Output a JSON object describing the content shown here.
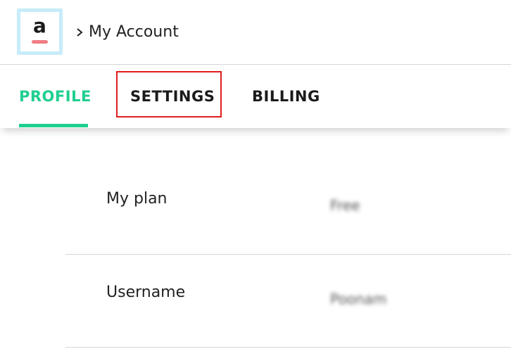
{
  "header": {
    "logo_letter": "a",
    "breadcrumb_title": "My Account",
    "accent_colors": {
      "logo_border": "#c8ecf9",
      "logo_bar": "#f07d84"
    }
  },
  "tabs": [
    {
      "label": "PROFILE",
      "active": true
    },
    {
      "label": "SETTINGS",
      "active": false,
      "highlighted": true
    },
    {
      "label": "BILLING",
      "active": false
    }
  ],
  "colors": {
    "active_tab": "#1fcf8f",
    "highlight_box": "#e21d1d"
  },
  "profile_rows": [
    {
      "label": "My plan",
      "value": "Free"
    },
    {
      "label": "Username",
      "value": "Poonam"
    }
  ]
}
